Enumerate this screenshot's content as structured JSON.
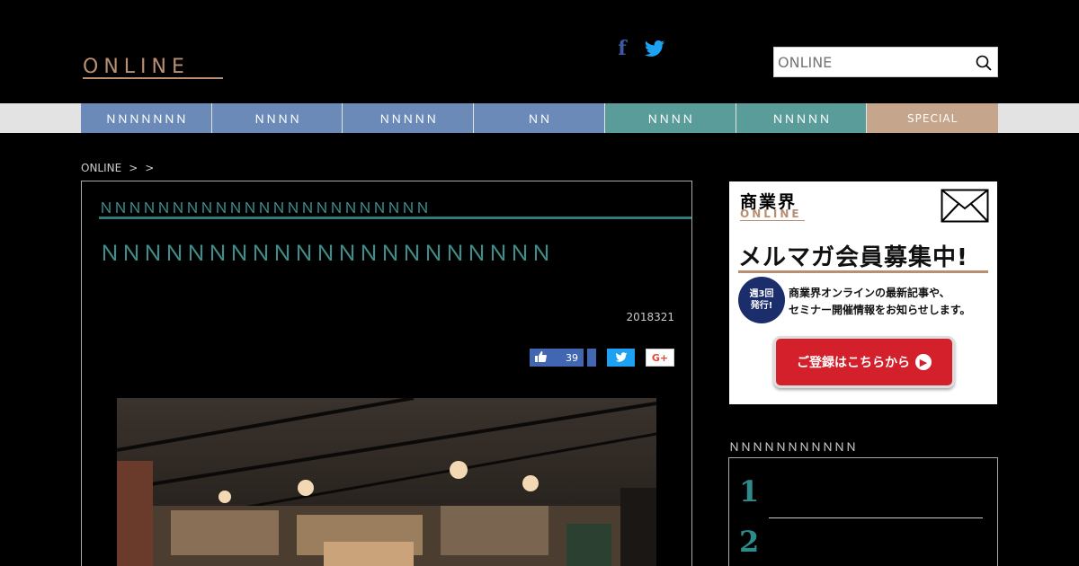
{
  "header": {
    "logo_text": "ONLINE",
    "search_placeholder": "ONLINE"
  },
  "social": {
    "facebook_glyph": "f"
  },
  "nav": {
    "items": [
      {
        "label": "ＮＮＮＮＮＮＮ"
      },
      {
        "label": "ＮＮＮＮ"
      },
      {
        "label": "ＮＮＮＮＮ"
      },
      {
        "label": "ＮＮ"
      },
      {
        "label": "ＮＮＮＮ"
      },
      {
        "label": "ＮＮＮＮＮ"
      },
      {
        "label": "SPECIAL"
      }
    ]
  },
  "breadcrumb": {
    "home": "ONLINE",
    "sep1": ">",
    "sep2": ">"
  },
  "article": {
    "category": "ＮＮＮＮＮＮＮＮＮＮＮＮＮＮＮＮＮＮＮＮＮＮＮ",
    "title": "ＮＮＮＮＮＮＮＮＮＮＮＮＮＮＮＮＮＮＮＮＮ",
    "date": "2018321",
    "like_count": "39",
    "gplus_label": "G+"
  },
  "ad": {
    "brand": "商業界",
    "brand_sub": "ONLINE",
    "headline": "メルマガ会員募集中!",
    "badge_line1": "週3回",
    "badge_line2": "発行!",
    "desc_line1": "商業界オンラインの最新記事や、",
    "desc_line2": "セミナー開催情報をお知らせします。",
    "cta": "ご登録はこちらから"
  },
  "ranking": {
    "title": "ＮＮＮＮＮＮＮＮＮＮＮ",
    "items": [
      {
        "rank": "1"
      },
      {
        "rank": "2"
      }
    ]
  },
  "colors": {
    "nav_blue": "#6b8ab8",
    "nav_teal": "#5a9c9a",
    "nav_special": "#c5a58c",
    "accent_teal": "#3f8f8f",
    "brand_bronze": "#b98f74",
    "cta_red": "#d4202a"
  }
}
